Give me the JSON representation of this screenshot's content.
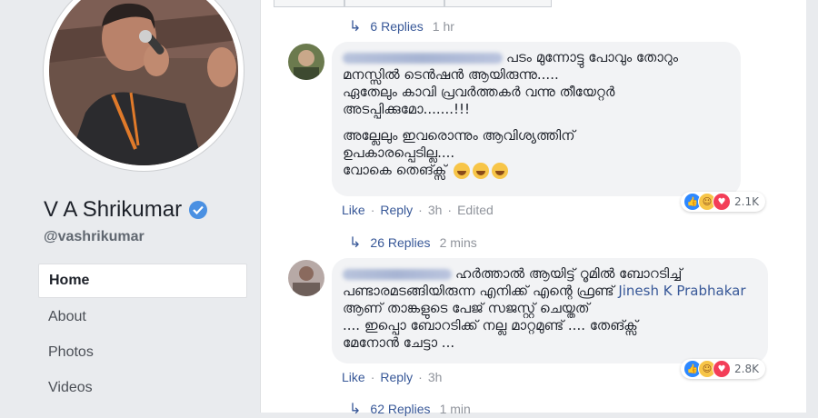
{
  "profile": {
    "name": "V A Shrikumar",
    "handle": "@vashrikumar",
    "nav": [
      {
        "label": "Home",
        "active": true
      },
      {
        "label": "About",
        "active": false
      },
      {
        "label": "Photos",
        "active": false
      },
      {
        "label": "Videos",
        "active": false
      }
    ]
  },
  "thread": {
    "top_replies": {
      "label": "6 Replies",
      "time": "1 hr"
    },
    "comments": [
      {
        "lines": [
          "പടം മുന്നോട്ടു പോവും തോറും",
          "മനസ്സിൽ ടെൻഷൻ ആയിരുന്നു.....",
          "ഏതേലും കാവി പ്രവർത്തകർ വന്നു തീയേറ്റർ",
          "അടപ്പിക്കുമോ.......!!!",
          "അല്ലേലും ഇവരൊന്നും ആവിശ്യത്തിന്",
          "ഉപകാരപ്പെടില്ല....",
          "വോകെ തെങ്ക്സ്"
        ],
        "actions": {
          "like": "Like",
          "reply": "Reply",
          "time": "3h",
          "edited": "Edited"
        },
        "reactions": "2.1K",
        "replies": {
          "label": "26 Replies",
          "time": "2 mins"
        }
      },
      {
        "lines_before_mention": "ഹർത്താൽ ആയിട്ട് റൂമിൽ ബോറടിച്ച്",
        "line2": "പണ്ടാരമടങ്ങിയിരുന്ന എനിക്ക് എന്റെ ഫ്രണ്ട്",
        "mention": "Jinesh K Prabhakar",
        "line3_rest": "ആണ് താങ്കളുടെ പേജ് സജസ്റ്റ് ചെയ്തത്",
        "line4": ".... ഇപ്പൊ ബോറടിക്ക് നല്ല മാറ്റമുണ്ട് .... തേങ്ക്സ്",
        "line5": "മേനോൻ ചേട്ടാ ...",
        "actions": {
          "like": "Like",
          "reply": "Reply",
          "time": "3h"
        },
        "reactions": "2.8K",
        "replies": {
          "label": "62 Replies",
          "time": "1 min"
        }
      }
    ]
  },
  "colors": {
    "link": "#385898",
    "bubble": "#f2f3f5",
    "muted": "#90949c",
    "verified": "#4a90e2"
  }
}
